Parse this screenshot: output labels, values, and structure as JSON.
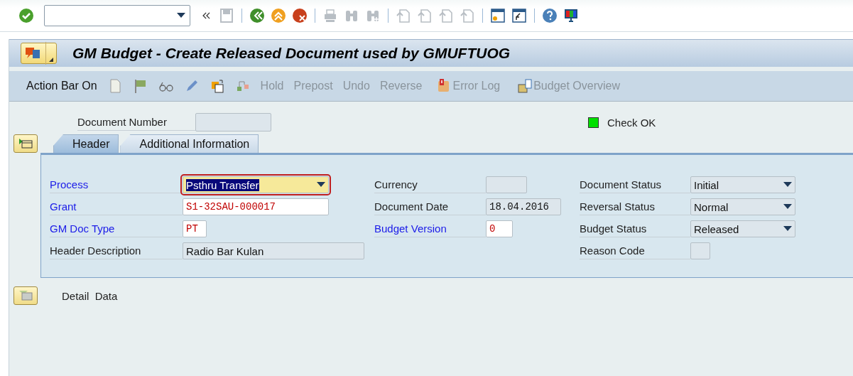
{
  "window": {
    "title": "GM Budget - Create Released Document used by GMUFTUOG"
  },
  "action_bar": [
    {
      "label": "Action Bar On",
      "disabled": false
    },
    {
      "label": "Hold",
      "disabled": true
    },
    {
      "label": "Prepost",
      "disabled": true
    },
    {
      "label": "Undo",
      "disabled": true
    },
    {
      "label": "Reverse",
      "disabled": true
    },
    {
      "label": "Error Log",
      "disabled": true
    },
    {
      "label": "Budget Overview",
      "disabled": true
    }
  ],
  "document_number": {
    "label": "Document Number"
  },
  "check_status": {
    "label": "Check OK",
    "color": "#00e000"
  },
  "tabs": [
    {
      "label": "Header",
      "selected": true
    },
    {
      "label": "Additional Information",
      "selected": false
    }
  ],
  "field_columns": [
    [
      {
        "label": "Process",
        "link": true,
        "kind": "dropdown",
        "value": "Psthru Transfer",
        "focused": true
      },
      {
        "label": "Grant",
        "link": true,
        "kind": "input",
        "value": "S1-32SAU-000017",
        "focused": false
      },
      {
        "label": "GM Doc Type",
        "link": true,
        "kind": "input",
        "value": "PT",
        "focused": false
      },
      {
        "label": "Header Description",
        "link": false,
        "kind": "readonly",
        "value": "Radio Bar Kulan",
        "focused": false
      }
    ],
    [
      {
        "label": "Currency",
        "link": false,
        "kind": "readonly",
        "focused": false
      },
      {
        "label": "Document Date",
        "link": false,
        "kind": "readonly",
        "value": "18.04.2016",
        "focused": false
      },
      {
        "label": "Budget Version",
        "link": true,
        "kind": "input",
        "value": "0",
        "focused": false
      }
    ],
    [
      {
        "label": "Document Status",
        "link": false,
        "kind": "dropdown",
        "value": "Initial",
        "focused": false
      },
      {
        "label": "Reversal Status",
        "link": false,
        "kind": "dropdown",
        "value": "Normal",
        "focused": false
      },
      {
        "label": "Budget Status",
        "link": false,
        "kind": "dropdown",
        "value": "Released",
        "focused": false
      },
      {
        "label": "Reason Code",
        "link": false,
        "kind": "readonly",
        "focused": false
      }
    ]
  ],
  "detail_section": {
    "label": "Detail  Data"
  }
}
